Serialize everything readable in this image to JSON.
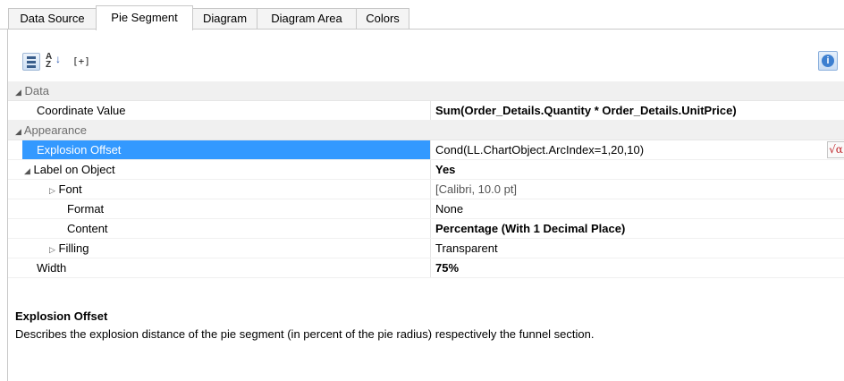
{
  "tabs": [
    {
      "label": "Data Source",
      "active": false
    },
    {
      "label": "Pie Segment",
      "active": true
    },
    {
      "label": "Diagram",
      "active": false
    },
    {
      "label": "Diagram Area",
      "active": false
    },
    {
      "label": "Colors",
      "active": false
    }
  ],
  "toolbar": {
    "categorized_icon": "categorized-icon",
    "alphabetical_icon": "sort-alphabetical-icon",
    "alphabetical_glyph_top": "A",
    "alphabetical_glyph_bottom": "Z",
    "expand_label": "[+]",
    "info_icon": "info-icon"
  },
  "properties": {
    "categories": {
      "data": "Data",
      "appearance": "Appearance"
    },
    "coordinate_value": {
      "name": "Coordinate Value",
      "value": "Sum(Order_Details.Quantity * Order_Details.UnitPrice)"
    },
    "explosion_offset": {
      "name": "Explosion Offset",
      "value": "Cond(LL.ChartObject.ArcIndex=1,20,10)"
    },
    "label_on_object": {
      "name": "Label on Object",
      "value": "Yes"
    },
    "font": {
      "name": "Font",
      "value": "[Calibri, 10.0 pt]"
    },
    "format": {
      "name": "Format",
      "value": "None"
    },
    "content": {
      "name": "Content",
      "value": "Percentage (With 1 Decimal Place)"
    },
    "filling": {
      "name": "Filling",
      "value": "Transparent"
    },
    "width": {
      "name": "Width",
      "value": "75%"
    }
  },
  "formula_button": {
    "label": "√α",
    "icon": "formula-wizard-icon"
  },
  "description": {
    "title": "Explosion Offset",
    "text": "Describes the explosion distance of the pie segment (in percent of the pie radius) respectively the funnel section."
  },
  "colors": {
    "selection": "#3399ff",
    "category_bg": "#f0f0f0",
    "accent": "#3c7fd0"
  }
}
